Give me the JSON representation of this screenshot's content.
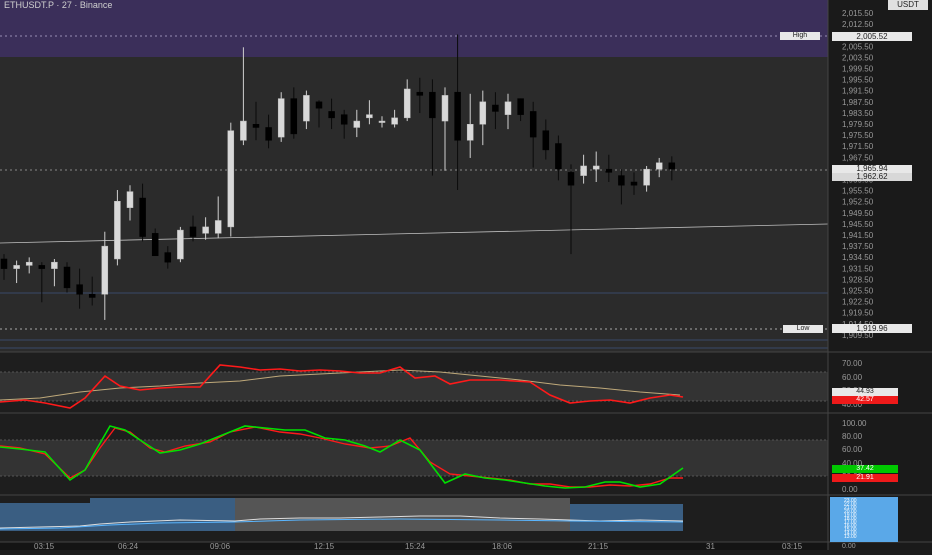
{
  "header": {
    "symbol_title": "ETHUSDT.P · 27 · Binance",
    "currency_label": "USDT"
  },
  "colors": {
    "background": "#2b2b2b",
    "axis_background": "#1a1a1a",
    "purple_zone": "#3b2f5a",
    "candle_up": "#d9d9d9",
    "candle_down": "#000000",
    "rsi_line": "#ff1a1a",
    "rsi_ma": "#bfa97a",
    "stoch_k": "#00e000",
    "stoch_d": "#ff1a1a",
    "volume_blue": "#3f6a94"
  },
  "price_axis": {
    "ticks": [
      "2,015.50",
      "2,012.50",
      "2,010.50",
      "2,005.50",
      "2,003.50",
      "1,999.50",
      "1,995.50",
      "1,991.50",
      "1,987.50",
      "1,983.50",
      "1,979.50",
      "1,975.50",
      "1,971.50",
      "1,967.50",
      "1,963.50",
      "1,959.50",
      "1,955.50",
      "1,952.50",
      "1,949.50",
      "1,945.50",
      "1,941.50",
      "1,937.50",
      "1,934.50",
      "1,931.50",
      "1,928.50",
      "1,925.50",
      "1,922.50",
      "1,919.50",
      "1,914.50",
      "1,909.50"
    ],
    "high_label": "High",
    "high_value": "2,005.52",
    "low_label": "Low",
    "low_value": "1,919.96",
    "current_price_a": "1,965.94",
    "current_price_b": "1,962.62"
  },
  "rsi_axis": {
    "ticks": [
      "70.00",
      "60.00",
      "50.00",
      "40.00"
    ],
    "value_a": "44.93",
    "value_b": "42.57"
  },
  "stoch_axis": {
    "ticks": [
      "100.00",
      "80.00",
      "60.00",
      "40.00",
      "20.00",
      "0.00"
    ],
    "value_k": "37.42",
    "value_d": "21.91"
  },
  "volume_axis": {
    "values": [
      "23.00",
      "22.00",
      "21.00",
      "20.00",
      "19.00",
      "18.00",
      "17.00",
      "16.00",
      "15.00",
      "14.00",
      "13.00"
    ],
    "zero": "0.00"
  },
  "time_axis": {
    "labels": [
      "03:15",
      "06:24",
      "09:06",
      "12:15",
      "15:24",
      "18:06",
      "21:15",
      "31",
      "03:15"
    ]
  },
  "chart_data": {
    "type": "candlestick",
    "ylim": [
      1909.5,
      2015.5
    ],
    "candles": [
      {
        "o": 1938.5,
        "h": 1940.0,
        "l": 1932.0,
        "c": 1935.5
      },
      {
        "o": 1935.5,
        "h": 1938.0,
        "l": 1931.0,
        "c": 1936.5
      },
      {
        "o": 1936.5,
        "h": 1939.0,
        "l": 1934.0,
        "c": 1937.5
      },
      {
        "o": 1936.5,
        "h": 1937.5,
        "l": 1925.0,
        "c": 1935.5
      },
      {
        "o": 1935.5,
        "h": 1938.5,
        "l": 1930.0,
        "c": 1937.5
      },
      {
        "o": 1936.0,
        "h": 1937.5,
        "l": 1928.0,
        "c": 1929.5
      },
      {
        "o": 1930.5,
        "h": 1935.5,
        "l": 1923.0,
        "c": 1927.5
      },
      {
        "o": 1927.5,
        "h": 1933.0,
        "l": 1924.0,
        "c": 1926.5
      },
      {
        "o": 1927.5,
        "h": 1947.0,
        "l": 1919.5,
        "c": 1942.5
      },
      {
        "o": 1938.5,
        "h": 1960.0,
        "l": 1936.5,
        "c": 1956.5
      },
      {
        "o": 1954.5,
        "h": 1961.5,
        "l": 1950.5,
        "c": 1959.5
      },
      {
        "o": 1957.5,
        "h": 1962.0,
        "l": 1944.0,
        "c": 1945.5
      },
      {
        "o": 1946.5,
        "h": 1948.0,
        "l": 1940.0,
        "c": 1939.5
      },
      {
        "o": 1940.5,
        "h": 1942.5,
        "l": 1935.5,
        "c": 1937.5
      },
      {
        "o": 1938.5,
        "h": 1948.5,
        "l": 1937.5,
        "c": 1947.5
      },
      {
        "o": 1948.5,
        "h": 1952.0,
        "l": 1944.0,
        "c": 1945.5
      },
      {
        "o": 1946.5,
        "h": 1951.5,
        "l": 1944.5,
        "c": 1948.5
      },
      {
        "o": 1946.5,
        "h": 1958.0,
        "l": 1945.0,
        "c": 1950.5
      },
      {
        "o": 1948.5,
        "h": 1981.0,
        "l": 1945.5,
        "c": 1978.5
      },
      {
        "o": 1975.5,
        "h": 2004.5,
        "l": 1974.0,
        "c": 1981.5
      },
      {
        "o": 1980.5,
        "h": 1987.5,
        "l": 1975.5,
        "c": 1979.5
      },
      {
        "o": 1979.5,
        "h": 1983.5,
        "l": 1973.0,
        "c": 1975.5
      },
      {
        "o": 1976.5,
        "h": 1990.5,
        "l": 1975.0,
        "c": 1988.5
      },
      {
        "o": 1988.5,
        "h": 1992.0,
        "l": 1976.0,
        "c": 1977.5
      },
      {
        "o": 1981.5,
        "h": 1991.0,
        "l": 1979.0,
        "c": 1989.5
      },
      {
        "o": 1987.5,
        "h": 1988.0,
        "l": 1979.5,
        "c": 1985.5
      },
      {
        "o": 1984.5,
        "h": 1988.5,
        "l": 1979.0,
        "c": 1982.5
      },
      {
        "o": 1983.5,
        "h": 1985.0,
        "l": 1976.0,
        "c": 1980.5
      },
      {
        "o": 1979.5,
        "h": 1985.0,
        "l": 1976.5,
        "c": 1981.5
      },
      {
        "o": 1982.5,
        "h": 1988.0,
        "l": 1980.5,
        "c": 1983.5
      },
      {
        "o": 1981.5,
        "h": 1983.0,
        "l": 1979.5,
        "c": 1981.5
      },
      {
        "o": 1980.5,
        "h": 1985.0,
        "l": 1979.5,
        "c": 1982.5
      },
      {
        "o": 1982.5,
        "h": 1994.5,
        "l": 1981.5,
        "c": 1991.5
      },
      {
        "o": 1990.5,
        "h": 1995.0,
        "l": 1984.0,
        "c": 1989.5
      },
      {
        "o": 1990.5,
        "h": 1994.5,
        "l": 1964.5,
        "c": 1982.5
      },
      {
        "o": 1981.5,
        "h": 1992.0,
        "l": 1966.0,
        "c": 1989.5
      },
      {
        "o": 1990.5,
        "h": 2008.5,
        "l": 1960.0,
        "c": 1975.5
      },
      {
        "o": 1975.5,
        "h": 1990.0,
        "l": 1970.0,
        "c": 1980.5
      },
      {
        "o": 1980.5,
        "h": 1991.0,
        "l": 1974.0,
        "c": 1987.5
      },
      {
        "o": 1986.5,
        "h": 1990.5,
        "l": 1979.0,
        "c": 1984.5
      },
      {
        "o": 1983.5,
        "h": 1990.0,
        "l": 1979.0,
        "c": 1987.5
      },
      {
        "o": 1988.5,
        "h": 1988.5,
        "l": 1981.5,
        "c": 1983.5
      },
      {
        "o": 1984.5,
        "h": 1987.5,
        "l": 1967.0,
        "c": 1976.5
      },
      {
        "o": 1978.5,
        "h": 1982.0,
        "l": 1969.5,
        "c": 1972.5
      },
      {
        "o": 1974.5,
        "h": 1977.0,
        "l": 1963.0,
        "c": 1966.5
      },
      {
        "o": 1965.5,
        "h": 1968.0,
        "l": 1940.0,
        "c": 1961.5
      },
      {
        "o": 1964.5,
        "h": 1971.0,
        "l": 1962.0,
        "c": 1967.5
      },
      {
        "o": 1966.5,
        "h": 1972.0,
        "l": 1962.5,
        "c": 1967.5
      },
      {
        "o": 1966.5,
        "h": 1971.0,
        "l": 1962.5,
        "c": 1965.5
      },
      {
        "o": 1964.5,
        "h": 1966.5,
        "l": 1955.5,
        "c": 1961.5
      },
      {
        "o": 1962.5,
        "h": 1965.5,
        "l": 1958.5,
        "c": 1961.5
      },
      {
        "o": 1961.5,
        "h": 1967.5,
        "l": 1959.5,
        "c": 1966.5
      },
      {
        "o": 1966.5,
        "h": 1970.0,
        "l": 1964.0,
        "c": 1968.5
      },
      {
        "o": 1968.5,
        "h": 1970.5,
        "l": 1963.0,
        "c": 1966.5
      }
    ],
    "rsi_axis_range": [
      35,
      75
    ]
  }
}
